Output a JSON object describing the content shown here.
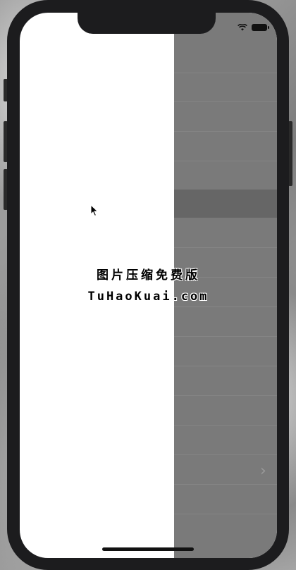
{
  "watermark": {
    "line1": "图片压缩免费版",
    "line2": "TuHaoKuai.com"
  },
  "status_bar": {
    "icons": [
      "wifi-icon",
      "battery-icon"
    ]
  },
  "list_panel": {
    "disclosure_icon": "chevron-right-icon",
    "disclosure_glyph": "›"
  },
  "colors": {
    "panel_background": "#7a7a7a",
    "highlight_band": "#666666",
    "screen_background": "#ffffff",
    "device_frame": "#1c1c1e"
  }
}
